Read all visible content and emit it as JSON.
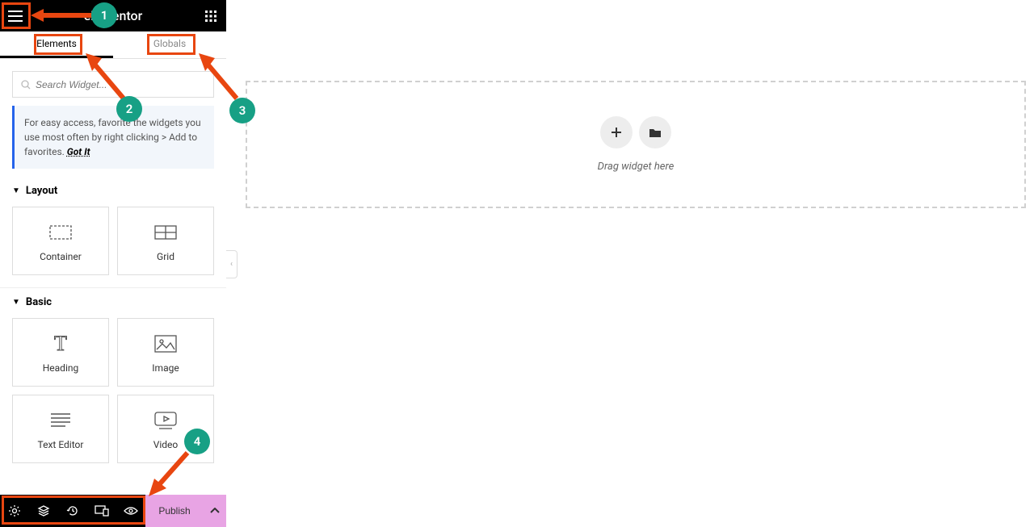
{
  "header": {
    "title": "elementor"
  },
  "tabs": {
    "elements": "Elements",
    "globals": "Globals"
  },
  "search": {
    "placeholder": "Search Widget..."
  },
  "tip": {
    "text": "For easy access, favorite the widgets you use most often by right clicking > Add to favorites.",
    "action": "Got It"
  },
  "sections": {
    "layout": {
      "title": "Layout",
      "items": [
        "Container",
        "Grid"
      ]
    },
    "basic": {
      "title": "Basic",
      "items": [
        "Heading",
        "Image",
        "Text Editor",
        "Video"
      ]
    }
  },
  "bottom": {
    "publish": "Publish"
  },
  "canvas": {
    "drop_label": "Drag widget here"
  },
  "annotations": {
    "n1": "1",
    "n2": "2",
    "n3": "3",
    "n4": "4"
  }
}
